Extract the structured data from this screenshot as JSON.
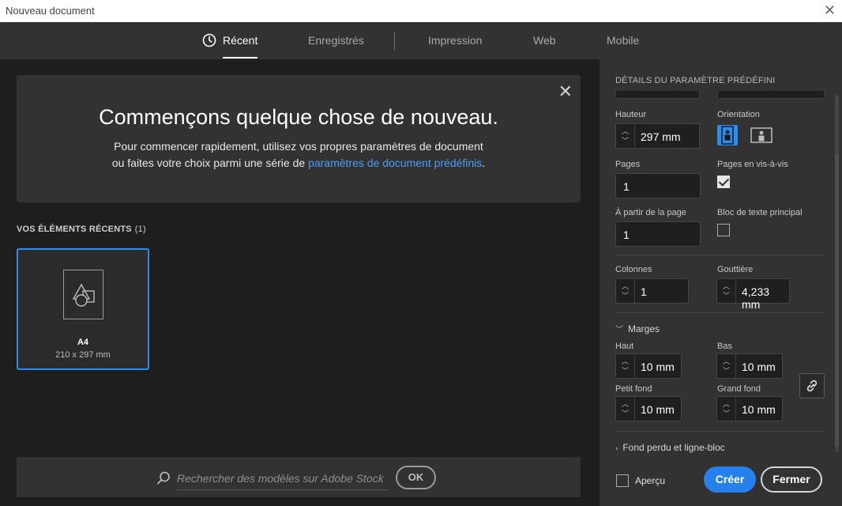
{
  "window": {
    "title": "Nouveau document",
    "close_icon": "close-icon"
  },
  "tabs": [
    {
      "label": "Récent",
      "active": true,
      "icon": "clock-icon"
    },
    {
      "label": "Enregistrés",
      "active": false
    },
    {
      "label": "Impression",
      "active": false
    },
    {
      "label": "Web",
      "active": false
    },
    {
      "label": "Mobile",
      "active": false
    }
  ],
  "banner": {
    "heading": "Commençons quelque chose de nouveau.",
    "line1": "Pour commencer rapidement, utilisez vos propres paramètres de document",
    "line2_prefix": "ou faites votre choix parmi une série de ",
    "line2_link": "paramètres de document prédéfinis",
    "line2_suffix": ".",
    "close_icon": "close-icon"
  },
  "recent": {
    "header": "VOS ÉLÉMENTS RÉCENTS",
    "count": "(1)",
    "items": [
      {
        "name": "A4",
        "size": "210 x 297 mm",
        "icon": "document-shapes-icon"
      }
    ]
  },
  "search": {
    "placeholder": "Rechercher des modèles sur Adobe Stock",
    "ok_label": "OK",
    "icon": "search-icon"
  },
  "preset": {
    "header": "DÉTAILS DU PARAMÈTRE PRÉDÉFINI",
    "hauteur_label": "Hauteur",
    "hauteur_value": "297 mm",
    "orientation_label": "Orientation",
    "orientation_selected": "portrait",
    "pages_label": "Pages",
    "pages_value": "1",
    "facing_label": "Pages en vis-à-vis",
    "facing_checked": true,
    "start_label": "À partir de la page",
    "start_value": "1",
    "primary_frame_label": "Bloc de texte principal",
    "primary_frame_checked": false,
    "colonnes_label": "Colonnes",
    "colonnes_value": "1",
    "gouttiere_label": "Gouttière",
    "gouttiere_value": "4,233 mm",
    "marges_label": "Marges",
    "haut_label": "Haut",
    "haut_value": "10 mm",
    "bas_label": "Bas",
    "bas_value": "10 mm",
    "petit_fond_label": "Petit fond",
    "petit_fond_value": "10 mm",
    "grand_fond_label": "Grand fond",
    "grand_fond_value": "10 mm",
    "bleed_label": "Fond perdu et ligne-bloc",
    "link_icon": "link-icon"
  },
  "footer": {
    "apercu_label": "Aperçu",
    "apercu_checked": false,
    "create_label": "Créer",
    "close_label": "Fermer"
  },
  "colors": {
    "accent": "#2680eb",
    "link": "#4b9cf5",
    "panel_bg": "#323232",
    "main_bg": "#1e1e1e"
  }
}
